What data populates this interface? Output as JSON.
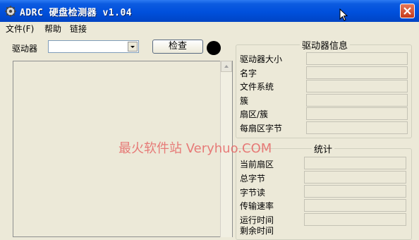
{
  "window": {
    "title": "ADRC 硬盘检测器 v1.04",
    "icons": {
      "app": "gear-icon",
      "close": "close-icon",
      "cursor": "mouse-cursor-icon"
    }
  },
  "menu": {
    "items": [
      "文件(F)",
      "帮助",
      "链接"
    ]
  },
  "drive": {
    "label": "驱动器",
    "value": "",
    "check_button": "检查"
  },
  "drive_info": {
    "title": "驱动器信息",
    "rows": [
      "驱动器大小",
      "名字",
      "文件系统",
      "簇",
      "扇区/簇",
      "每扇区字节"
    ]
  },
  "stats": {
    "title": "统计",
    "rows": [
      "当前扇区",
      "总字节",
      "字节读",
      "传输速率",
      "运行时间",
      "剩余时间"
    ]
  },
  "watermark": "最火软件站 Veryhuo.COM",
  "colors": {
    "titlebar": "#0050dc",
    "window_bg": "#ece9d8",
    "close": "#c63a1a",
    "watermark": "#e66767"
  }
}
